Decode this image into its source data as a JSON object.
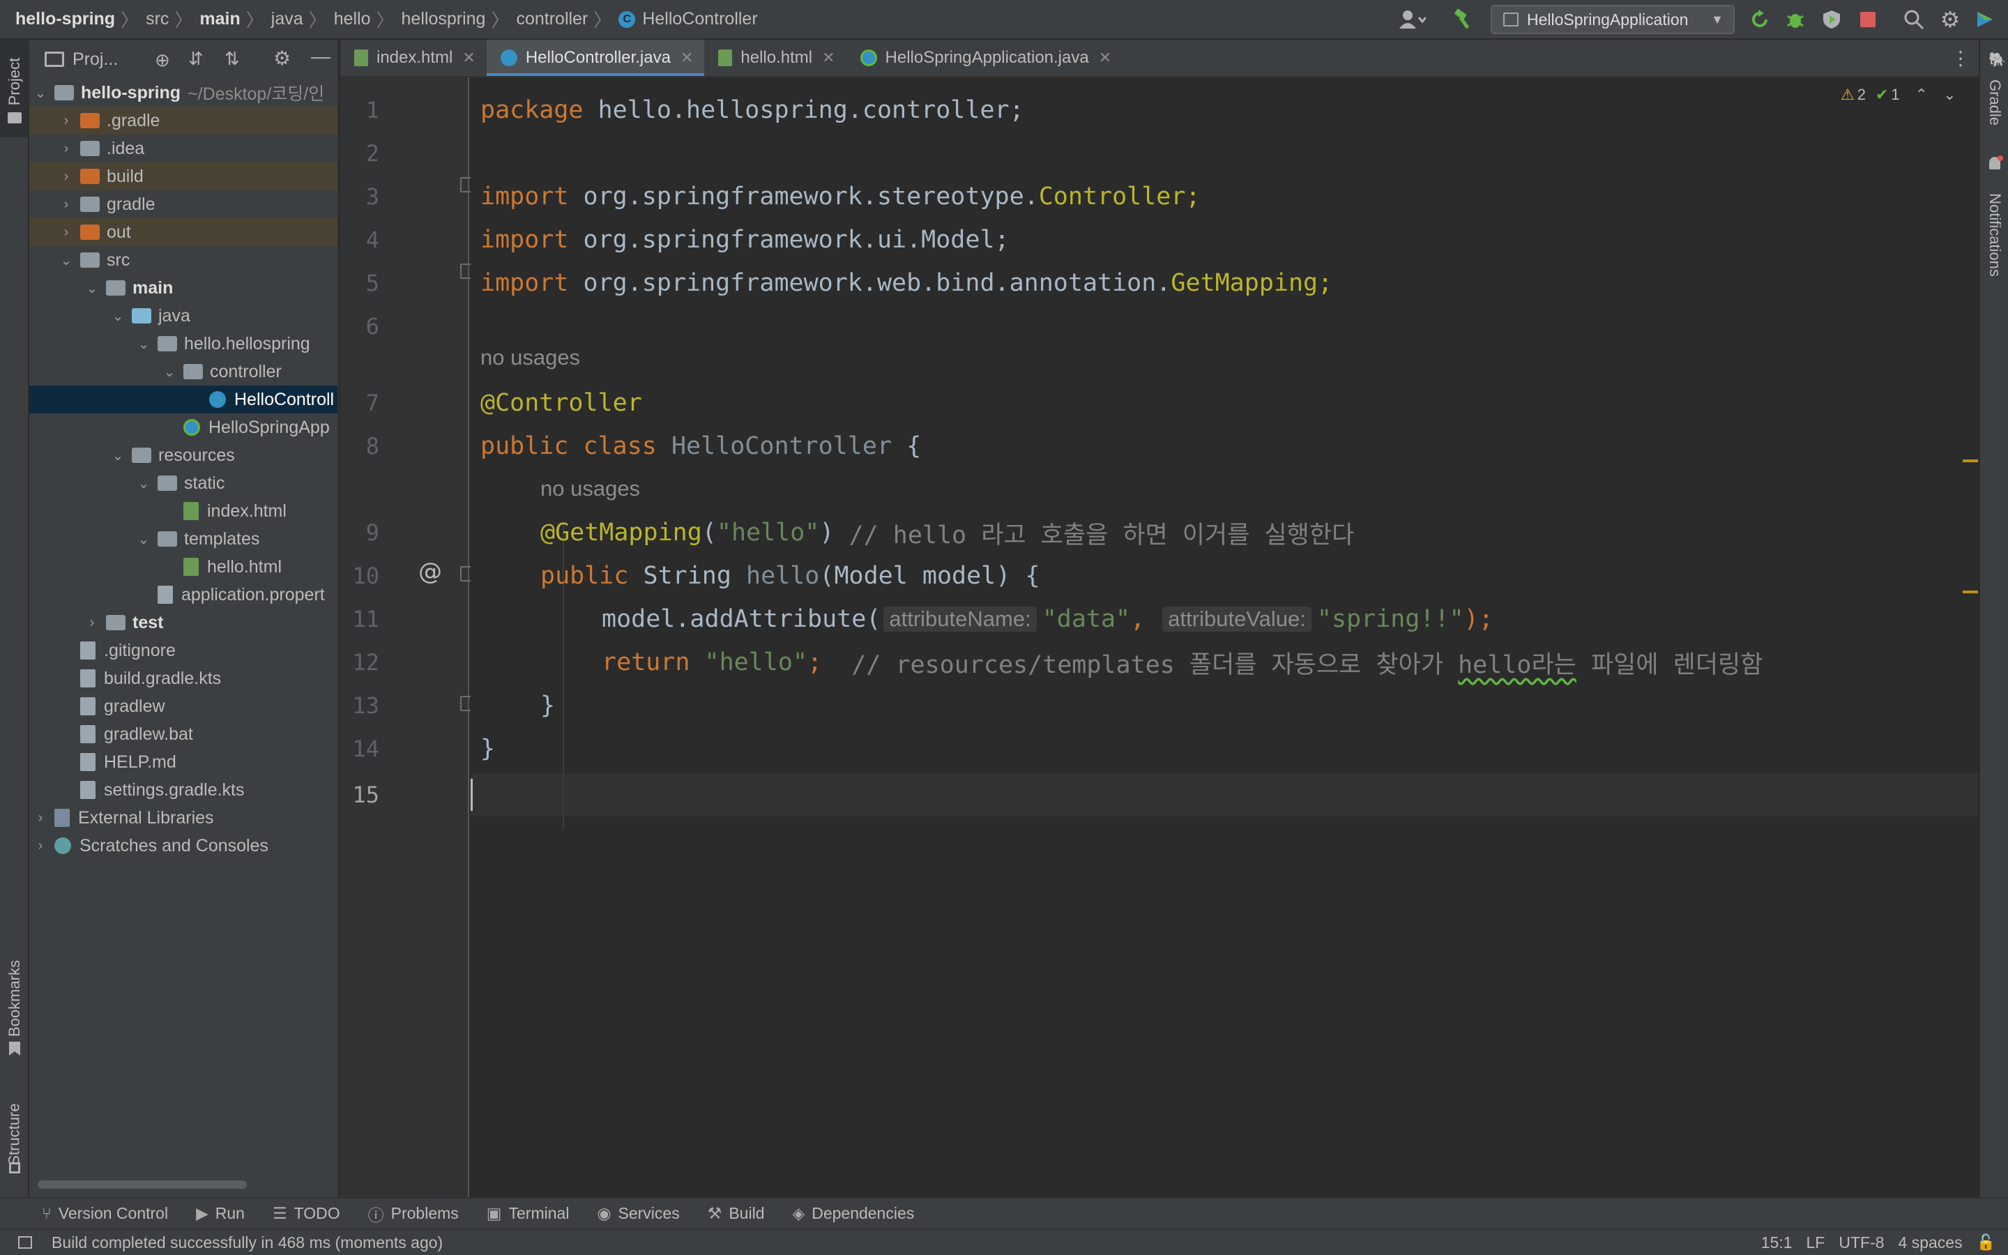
{
  "breadcrumb": [
    "hello-spring",
    "src",
    "main",
    "java",
    "hello",
    "hellospring",
    "controller",
    "HelloController"
  ],
  "run_config": "HelloSpringApplication",
  "project_panel": {
    "title": "Proj...",
    "root_name": "hello-spring",
    "root_path": "~/Desktop/코딩/인",
    "items": [
      {
        "label": ".gradle",
        "depth": 1,
        "kind": "folder-orange",
        "arrow": "›",
        "hl": true
      },
      {
        "label": ".idea",
        "depth": 1,
        "kind": "folder",
        "arrow": "›"
      },
      {
        "label": "build",
        "depth": 1,
        "kind": "folder-orange",
        "arrow": "›",
        "hl": true
      },
      {
        "label": "gradle",
        "depth": 1,
        "kind": "folder",
        "arrow": "›"
      },
      {
        "label": "out",
        "depth": 1,
        "kind": "folder-orange",
        "arrow": "›",
        "hl": true
      },
      {
        "label": "src",
        "depth": 1,
        "kind": "folder",
        "arrow": "⌄"
      },
      {
        "label": "main",
        "depth": 2,
        "kind": "folder",
        "arrow": "⌄",
        "bold": true
      },
      {
        "label": "java",
        "depth": 3,
        "kind": "folder-blue",
        "arrow": "⌄"
      },
      {
        "label": "hello.hellospring",
        "depth": 4,
        "kind": "folder",
        "arrow": "⌄"
      },
      {
        "label": "controller",
        "depth": 5,
        "kind": "folder",
        "arrow": "⌄"
      },
      {
        "label": "HelloControll",
        "depth": 6,
        "kind": "class",
        "arrow": "",
        "sel": true
      },
      {
        "label": "HelloSpringApp",
        "depth": 5,
        "kind": "spring",
        "arrow": ""
      },
      {
        "label": "resources",
        "depth": 3,
        "kind": "folder",
        "arrow": "⌄"
      },
      {
        "label": "static",
        "depth": 4,
        "kind": "folder",
        "arrow": "⌄"
      },
      {
        "label": "index.html",
        "depth": 5,
        "kind": "html",
        "arrow": ""
      },
      {
        "label": "templates",
        "depth": 4,
        "kind": "folder",
        "arrow": "⌄"
      },
      {
        "label": "hello.html",
        "depth": 5,
        "kind": "html",
        "arrow": ""
      },
      {
        "label": "application.propert",
        "depth": 4,
        "kind": "file",
        "arrow": ""
      },
      {
        "label": "test",
        "depth": 2,
        "kind": "folder",
        "arrow": "›",
        "bold": true
      },
      {
        "label": ".gitignore",
        "depth": 1,
        "kind": "file",
        "arrow": ""
      },
      {
        "label": "build.gradle.kts",
        "depth": 1,
        "kind": "file",
        "arrow": ""
      },
      {
        "label": "gradlew",
        "depth": 1,
        "kind": "file",
        "arrow": ""
      },
      {
        "label": "gradlew.bat",
        "depth": 1,
        "kind": "file",
        "arrow": ""
      },
      {
        "label": "HELP.md",
        "depth": 1,
        "kind": "file",
        "arrow": ""
      },
      {
        "label": "settings.gradle.kts",
        "depth": 1,
        "kind": "file",
        "arrow": ""
      },
      {
        "label": "External Libraries",
        "depth": 0,
        "kind": "lib",
        "arrow": "›"
      },
      {
        "label": "Scratches and Consoles",
        "depth": 0,
        "kind": "scratch",
        "arrow": "›"
      }
    ]
  },
  "tabs": [
    {
      "label": "index.html",
      "kind": "html",
      "active": false
    },
    {
      "label": "HelloController.java",
      "kind": "class",
      "active": true
    },
    {
      "label": "hello.html",
      "kind": "html",
      "active": false
    },
    {
      "label": "HelloSpringApplication.java",
      "kind": "spring",
      "active": false
    }
  ],
  "inspections": {
    "warnings": "2",
    "ok": "1"
  },
  "code": {
    "usages": "no usages",
    "l1_kw": "package",
    "l1_rest": " hello.hellospring.controller;",
    "l3_kw": "import",
    "l3_a": " org.springframework.stereotype.",
    "l3_b": "Controller;",
    "l4_kw": "import",
    "l4_a": " org.springframework.ui.Model;",
    "l5_kw": "import",
    "l5_a": " org.springframework.web.bind.annotation.",
    "l5_b": "GetMapping;",
    "l7": "@Controller",
    "l8_kw": "public class",
    "l8_name": " HelloController",
    "l8_rest": " {",
    "l9_ann": "@GetMapping",
    "l9_p1": "(",
    "l9_str": "\"hello\"",
    "l9_p2": ") ",
    "l9_cmt": "// hello 라고 호출을 하면 이거를 실행한다",
    "l10_kw": "public",
    "l10_a": " String ",
    "l10_name": "hello",
    "l10_b": "(Model model) {",
    "l11_a": "model.addAttribute(",
    "l11_hint1": "attributeName:",
    "l11_s1": "\"data\"",
    "l11_comma": ",",
    "l11_hint2": "attributeValue:",
    "l11_s2": "\"spring!!\"",
    "l11_end": ");",
    "l12_kw": "return",
    "l12_str": " \"hello\"",
    "l12_semi": ";  ",
    "l12_cmt1": "// resources/templates 폴더를 자동으로 찾아가 ",
    "l12_sq": "hello라는",
    "l12_cmt2": " 파일에 렌더링함",
    "l13": "}",
    "l14": "}"
  },
  "line_numbers": [
    "1",
    "2",
    "3",
    "4",
    "5",
    "6",
    "7",
    "8",
    "9",
    "10",
    "11",
    "12",
    "13",
    "14",
    "15"
  ],
  "left_tool_windows": {
    "project": "Project",
    "bookmarks": "Bookmarks",
    "structure": "Structure"
  },
  "right_tool_windows": {
    "gradle": "Gradle",
    "notifications": "Notifications"
  },
  "bottom_tools": [
    "Version Control",
    "Run",
    "TODO",
    "Problems",
    "Terminal",
    "Services",
    "Build",
    "Dependencies"
  ],
  "status": {
    "message": "Build completed successfully in 468 ms (moments ago)",
    "position": "15:1",
    "line_sep": "LF",
    "encoding": "UTF-8",
    "indent": "4 spaces"
  },
  "colors": {
    "keyword": "#cc7832",
    "annotation": "#bbb529",
    "string": "#6a8759",
    "comment": "#808080",
    "selection": "#0d293e"
  }
}
